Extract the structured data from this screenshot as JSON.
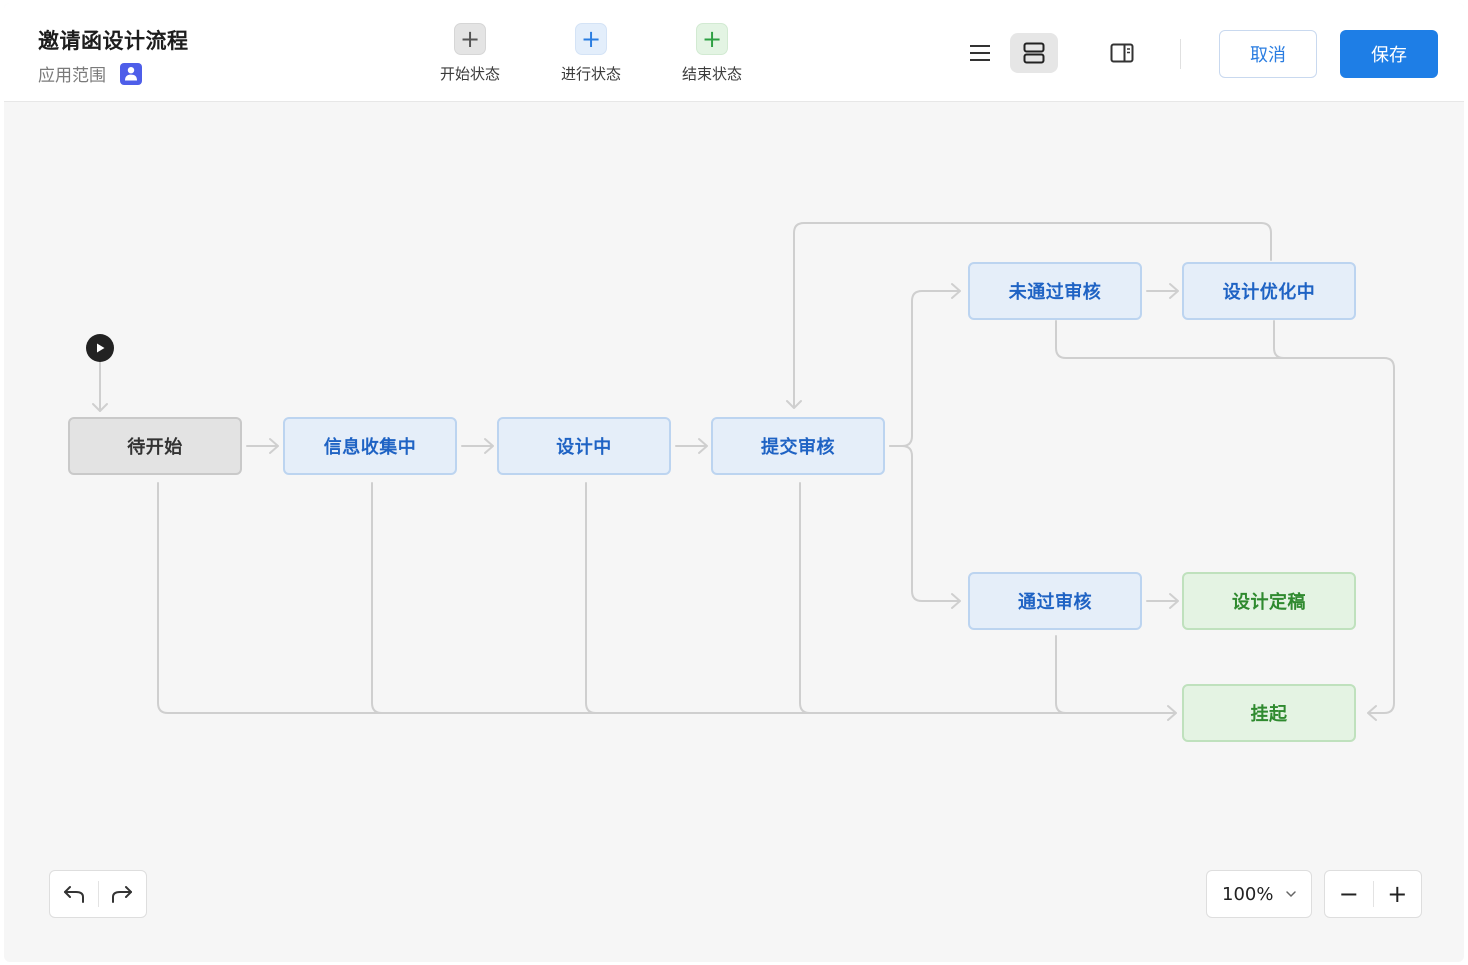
{
  "header": {
    "title": "邀请函设计流程",
    "scope_label": "应用范围",
    "scope_icon": "user-icon"
  },
  "toolbar": {
    "tools": [
      {
        "label": "开始状态",
        "symbol": "+",
        "color": "#555555"
      },
      {
        "label": "进行状态",
        "symbol": "+",
        "color": "#2a7de1"
      },
      {
        "label": "结束状态",
        "symbol": "+",
        "color": "#2ea043"
      }
    ],
    "view_modes": [
      "list-view-icon",
      "card-view-icon",
      "side-panel-icon"
    ],
    "active_view": "card-view-icon",
    "cancel_label": "取消",
    "save_label": "保存"
  },
  "flow": {
    "nodes": [
      {
        "id": "pending",
        "label": "待开始",
        "kind": "start"
      },
      {
        "id": "collect",
        "label": "信息收集中",
        "kind": "in-progress"
      },
      {
        "id": "design",
        "label": "设计中",
        "kind": "in-progress"
      },
      {
        "id": "submit",
        "label": "提交审核",
        "kind": "in-progress"
      },
      {
        "id": "rejected",
        "label": "未通过审核",
        "kind": "in-progress"
      },
      {
        "id": "optimize",
        "label": "设计优化中",
        "kind": "in-progress"
      },
      {
        "id": "approved",
        "label": "通过审核",
        "kind": "in-progress"
      },
      {
        "id": "finalized",
        "label": "设计定稿",
        "kind": "end"
      },
      {
        "id": "suspended",
        "label": "挂起",
        "kind": "end"
      }
    ],
    "transitions": [
      [
        "pending",
        "collect"
      ],
      [
        "collect",
        "design"
      ],
      [
        "design",
        "submit"
      ],
      [
        "submit",
        "rejected"
      ],
      [
        "submit",
        "approved"
      ],
      [
        "rejected",
        "optimize"
      ],
      [
        "optimize",
        "submit"
      ],
      [
        "approved",
        "finalized"
      ],
      [
        "pending",
        "suspended"
      ],
      [
        "collect",
        "suspended"
      ],
      [
        "design",
        "suspended"
      ],
      [
        "submit",
        "suspended"
      ],
      [
        "approved",
        "suspended"
      ],
      [
        "rejected",
        "suspended"
      ],
      [
        "optimize",
        "suspended"
      ]
    ]
  },
  "footer": {
    "zoom_level": "100%",
    "zoom_out_symbol": "−",
    "zoom_in_symbol": "+"
  }
}
